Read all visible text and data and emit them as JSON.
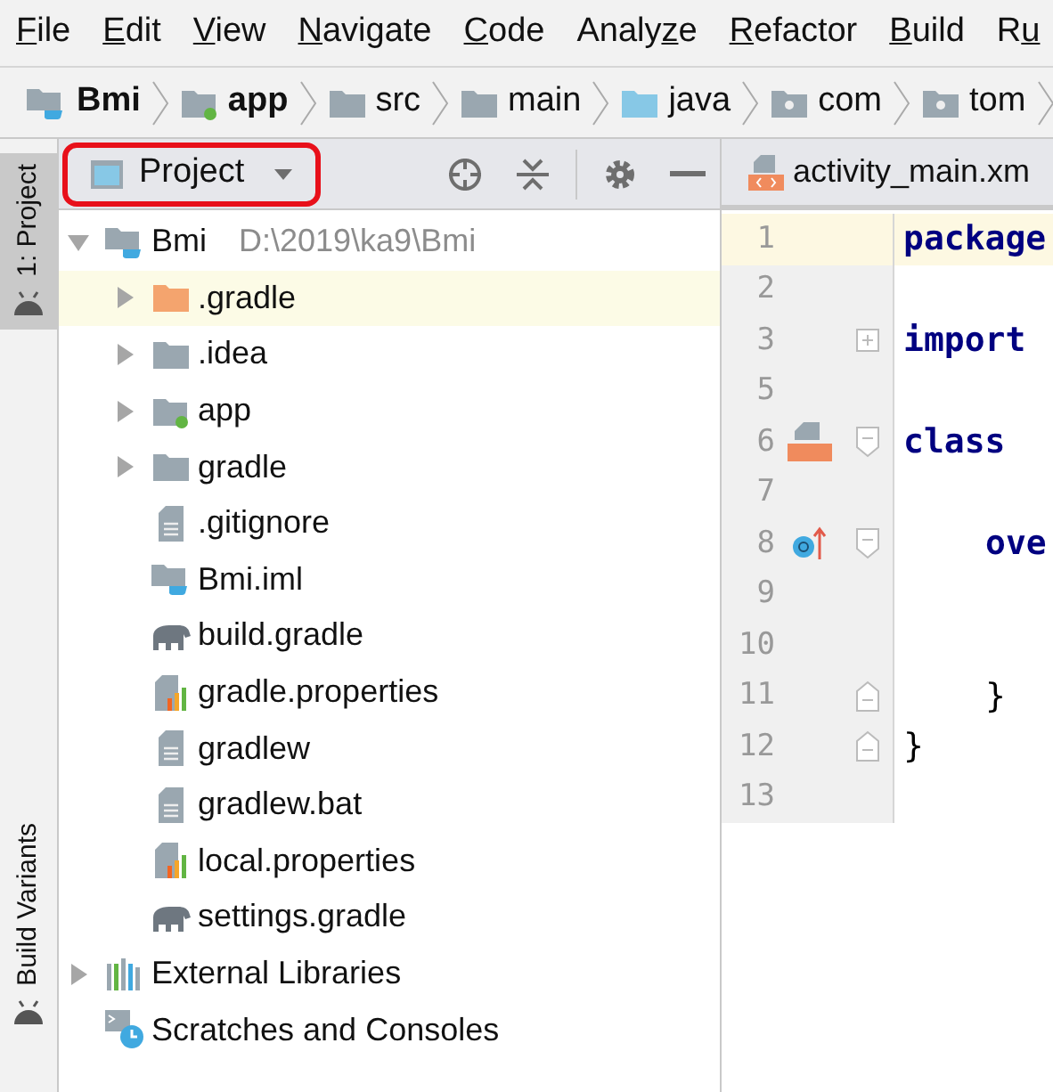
{
  "menu": [
    {
      "key": "F",
      "post": "ile"
    },
    {
      "key": "E",
      "post": "dit"
    },
    {
      "key": "V",
      "post": "iew"
    },
    {
      "key": "N",
      "post": "avigate"
    },
    {
      "key": "C",
      "post": "ode"
    },
    {
      "pre": "Analy",
      "key": "z",
      "post": "e"
    },
    {
      "key": "R",
      "post": "efactor"
    },
    {
      "key": "B",
      "post": "uild"
    },
    {
      "pre": "R",
      "key": "u"
    }
  ],
  "breadcrumb": [
    {
      "label": "Bmi",
      "kind": "module",
      "bold": true
    },
    {
      "label": "app",
      "kind": "app-module",
      "bold": true
    },
    {
      "label": "src",
      "kind": "folder",
      "bold": false
    },
    {
      "label": "main",
      "kind": "folder",
      "bold": false
    },
    {
      "label": "java",
      "kind": "source-folder",
      "bold": false
    },
    {
      "label": "com",
      "kind": "package",
      "bold": false
    },
    {
      "label": "tom",
      "kind": "package",
      "bold": false
    }
  ],
  "side_tabs": [
    {
      "label": "1: Project",
      "selected": true
    },
    {
      "label": "Build Variants",
      "selected": false
    }
  ],
  "project_panel": {
    "view": "Project",
    "tree": [
      {
        "label": "Bmi",
        "path": "D:\\2019\\ka9\\Bmi",
        "kind": "module",
        "expanded": true,
        "highlighted": false,
        "children": [
          {
            "label": ".gradle",
            "kind": "excluded-folder",
            "expanded": false,
            "highlighted": true
          },
          {
            "label": ".idea",
            "kind": "folder",
            "expanded": false,
            "highlighted": false
          },
          {
            "label": "app",
            "kind": "app-module",
            "expanded": false,
            "highlighted": false
          },
          {
            "label": "gradle",
            "kind": "folder",
            "expanded": false,
            "highlighted": false
          },
          {
            "label": ".gitignore",
            "kind": "text-file",
            "highlighted": false
          },
          {
            "label": "Bmi.iml",
            "kind": "module",
            "highlighted": false
          },
          {
            "label": "build.gradle",
            "kind": "gradle",
            "highlighted": false
          },
          {
            "label": "gradle.properties",
            "kind": "properties",
            "highlighted": false
          },
          {
            "label": "gradlew",
            "kind": "text-file",
            "highlighted": false
          },
          {
            "label": "gradlew.bat",
            "kind": "text-file",
            "highlighted": false
          },
          {
            "label": "local.properties",
            "kind": "properties",
            "highlighted": false
          },
          {
            "label": "settings.gradle",
            "kind": "gradle",
            "highlighted": false
          }
        ]
      },
      {
        "label": "External Libraries",
        "kind": "libraries",
        "expanded": false,
        "highlighted": false
      },
      {
        "label": "Scratches and Consoles",
        "kind": "scratches",
        "highlighted": false
      }
    ]
  },
  "editor": {
    "tab": "activity_main.xm",
    "lines": [
      {
        "number": "1",
        "code": "package",
        "current": true,
        "indent": false
      },
      {
        "number": "2",
        "current": false
      },
      {
        "number": "3",
        "code": "import",
        "current": false,
        "fold": {
          "kind": "plus"
        },
        "indent": false
      },
      {
        "number": "5",
        "current": false
      },
      {
        "number": "6",
        "code": "class",
        "current": false,
        "fold": {
          "kind": "open"
        },
        "gutter_icon": {
          "kind": "xml"
        },
        "indent": false
      },
      {
        "number": "7",
        "current": false
      },
      {
        "number": "8",
        "code": "ove",
        "current": false,
        "fold": {
          "kind": "open"
        },
        "gutter_icon": {
          "kind": "override"
        },
        "indent": true
      },
      {
        "number": "9",
        "current": false
      },
      {
        "number": "10",
        "current": false
      },
      {
        "number": "11",
        "code": "}",
        "current": false,
        "fold": {
          "kind": "close"
        },
        "indent": true
      },
      {
        "number": "12",
        "code": "}",
        "current": false,
        "fold": {
          "kind": "close"
        },
        "indent": false
      },
      {
        "number": "13",
        "current": false
      }
    ]
  }
}
